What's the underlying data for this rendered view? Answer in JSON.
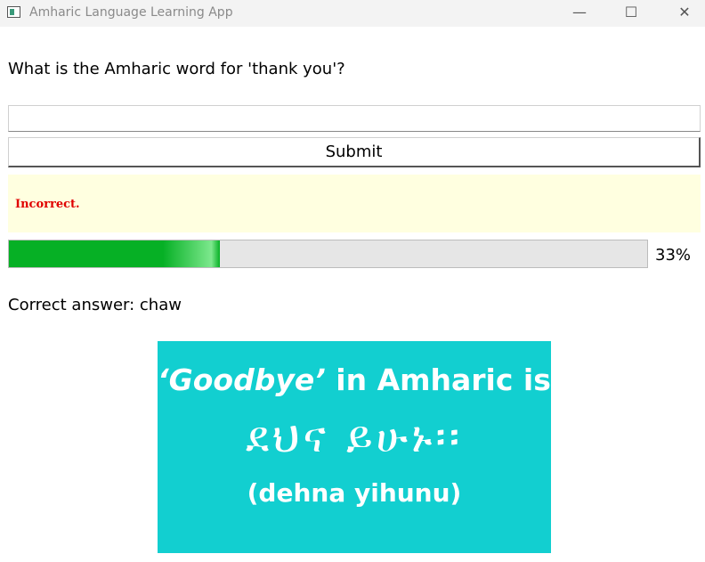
{
  "window": {
    "title": "Amharic Language Learning App",
    "minimize_glyph": "—",
    "maximize_glyph": "☐",
    "close_glyph": "✕"
  },
  "quiz": {
    "question": "What is the Amharic word for 'thank you'?",
    "answer_value": "",
    "submit_label": "Submit",
    "feedback": "Incorrect.",
    "progress_percent": 33,
    "progress_label": "33%",
    "correct_answer_text": "Correct answer: chaw"
  },
  "image": {
    "line1_quoted": "‘Goodbye’",
    "line1_rest": " in Amharic is",
    "line2": "ደህና ይሁኑ፡፡",
    "line3": "(dehna yihunu)"
  },
  "colors": {
    "progress_fill": "#06b025",
    "feedback_bg": "#ffffe0",
    "feedback_text": "#e00000",
    "image_bg": "#12cfd0"
  }
}
